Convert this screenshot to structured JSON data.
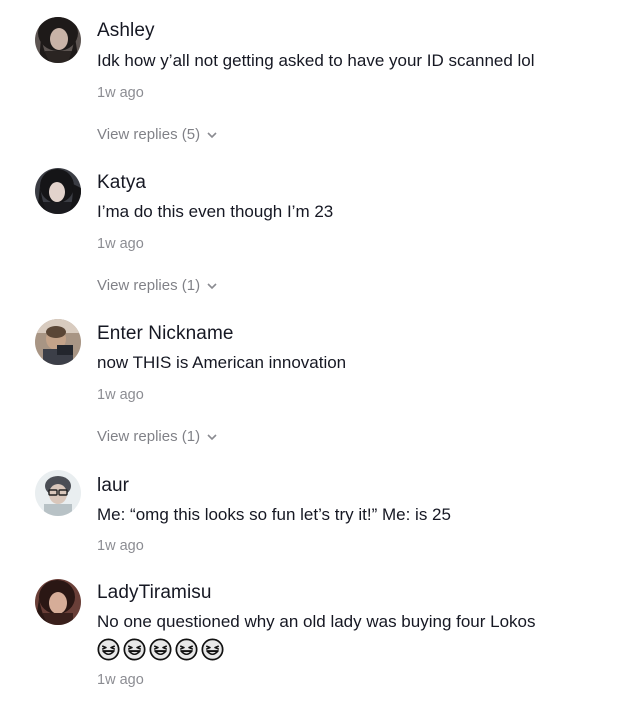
{
  "comments": [
    {
      "username": "Ashley",
      "text": "Idk how y’all not getting asked to have your ID scanned lol",
      "time": "1w ago",
      "replies": "View replies (5)",
      "avatar_color": "#3a302e"
    },
    {
      "username": "Katya",
      "text": "I’ma do this even though I’m 23",
      "time": "1w ago",
      "replies": "View replies (1)",
      "avatar_color": "#2b2b30"
    },
    {
      "username": "Enter Nickname",
      "text": "now THIS is American innovation",
      "time": "1w ago",
      "replies": "View replies (1)",
      "avatar_color": "#8a7a6a"
    },
    {
      "username": "laur",
      "text": "Me: “omg this looks so fun let’s try it!” Me: is 25",
      "time": "1w ago",
      "avatar_color": "#cfd6d8"
    },
    {
      "username": "LadyTiramisu",
      "text": "No one questioned why an old lady was buying four Lokos",
      "emojis": [
        "grinning-squinting-face-icon",
        "grinning-squinting-face-icon",
        "grinning-squinting-face-icon",
        "grinning-squinting-face-icon",
        "grinning-squinting-face-icon"
      ],
      "time": "1w ago",
      "avatar_color": "#4a2e2a"
    }
  ],
  "colors": {
    "primary_text": "#161823",
    "secondary_text": "#8a8b91",
    "emoji_face": "#e8e8e8"
  }
}
